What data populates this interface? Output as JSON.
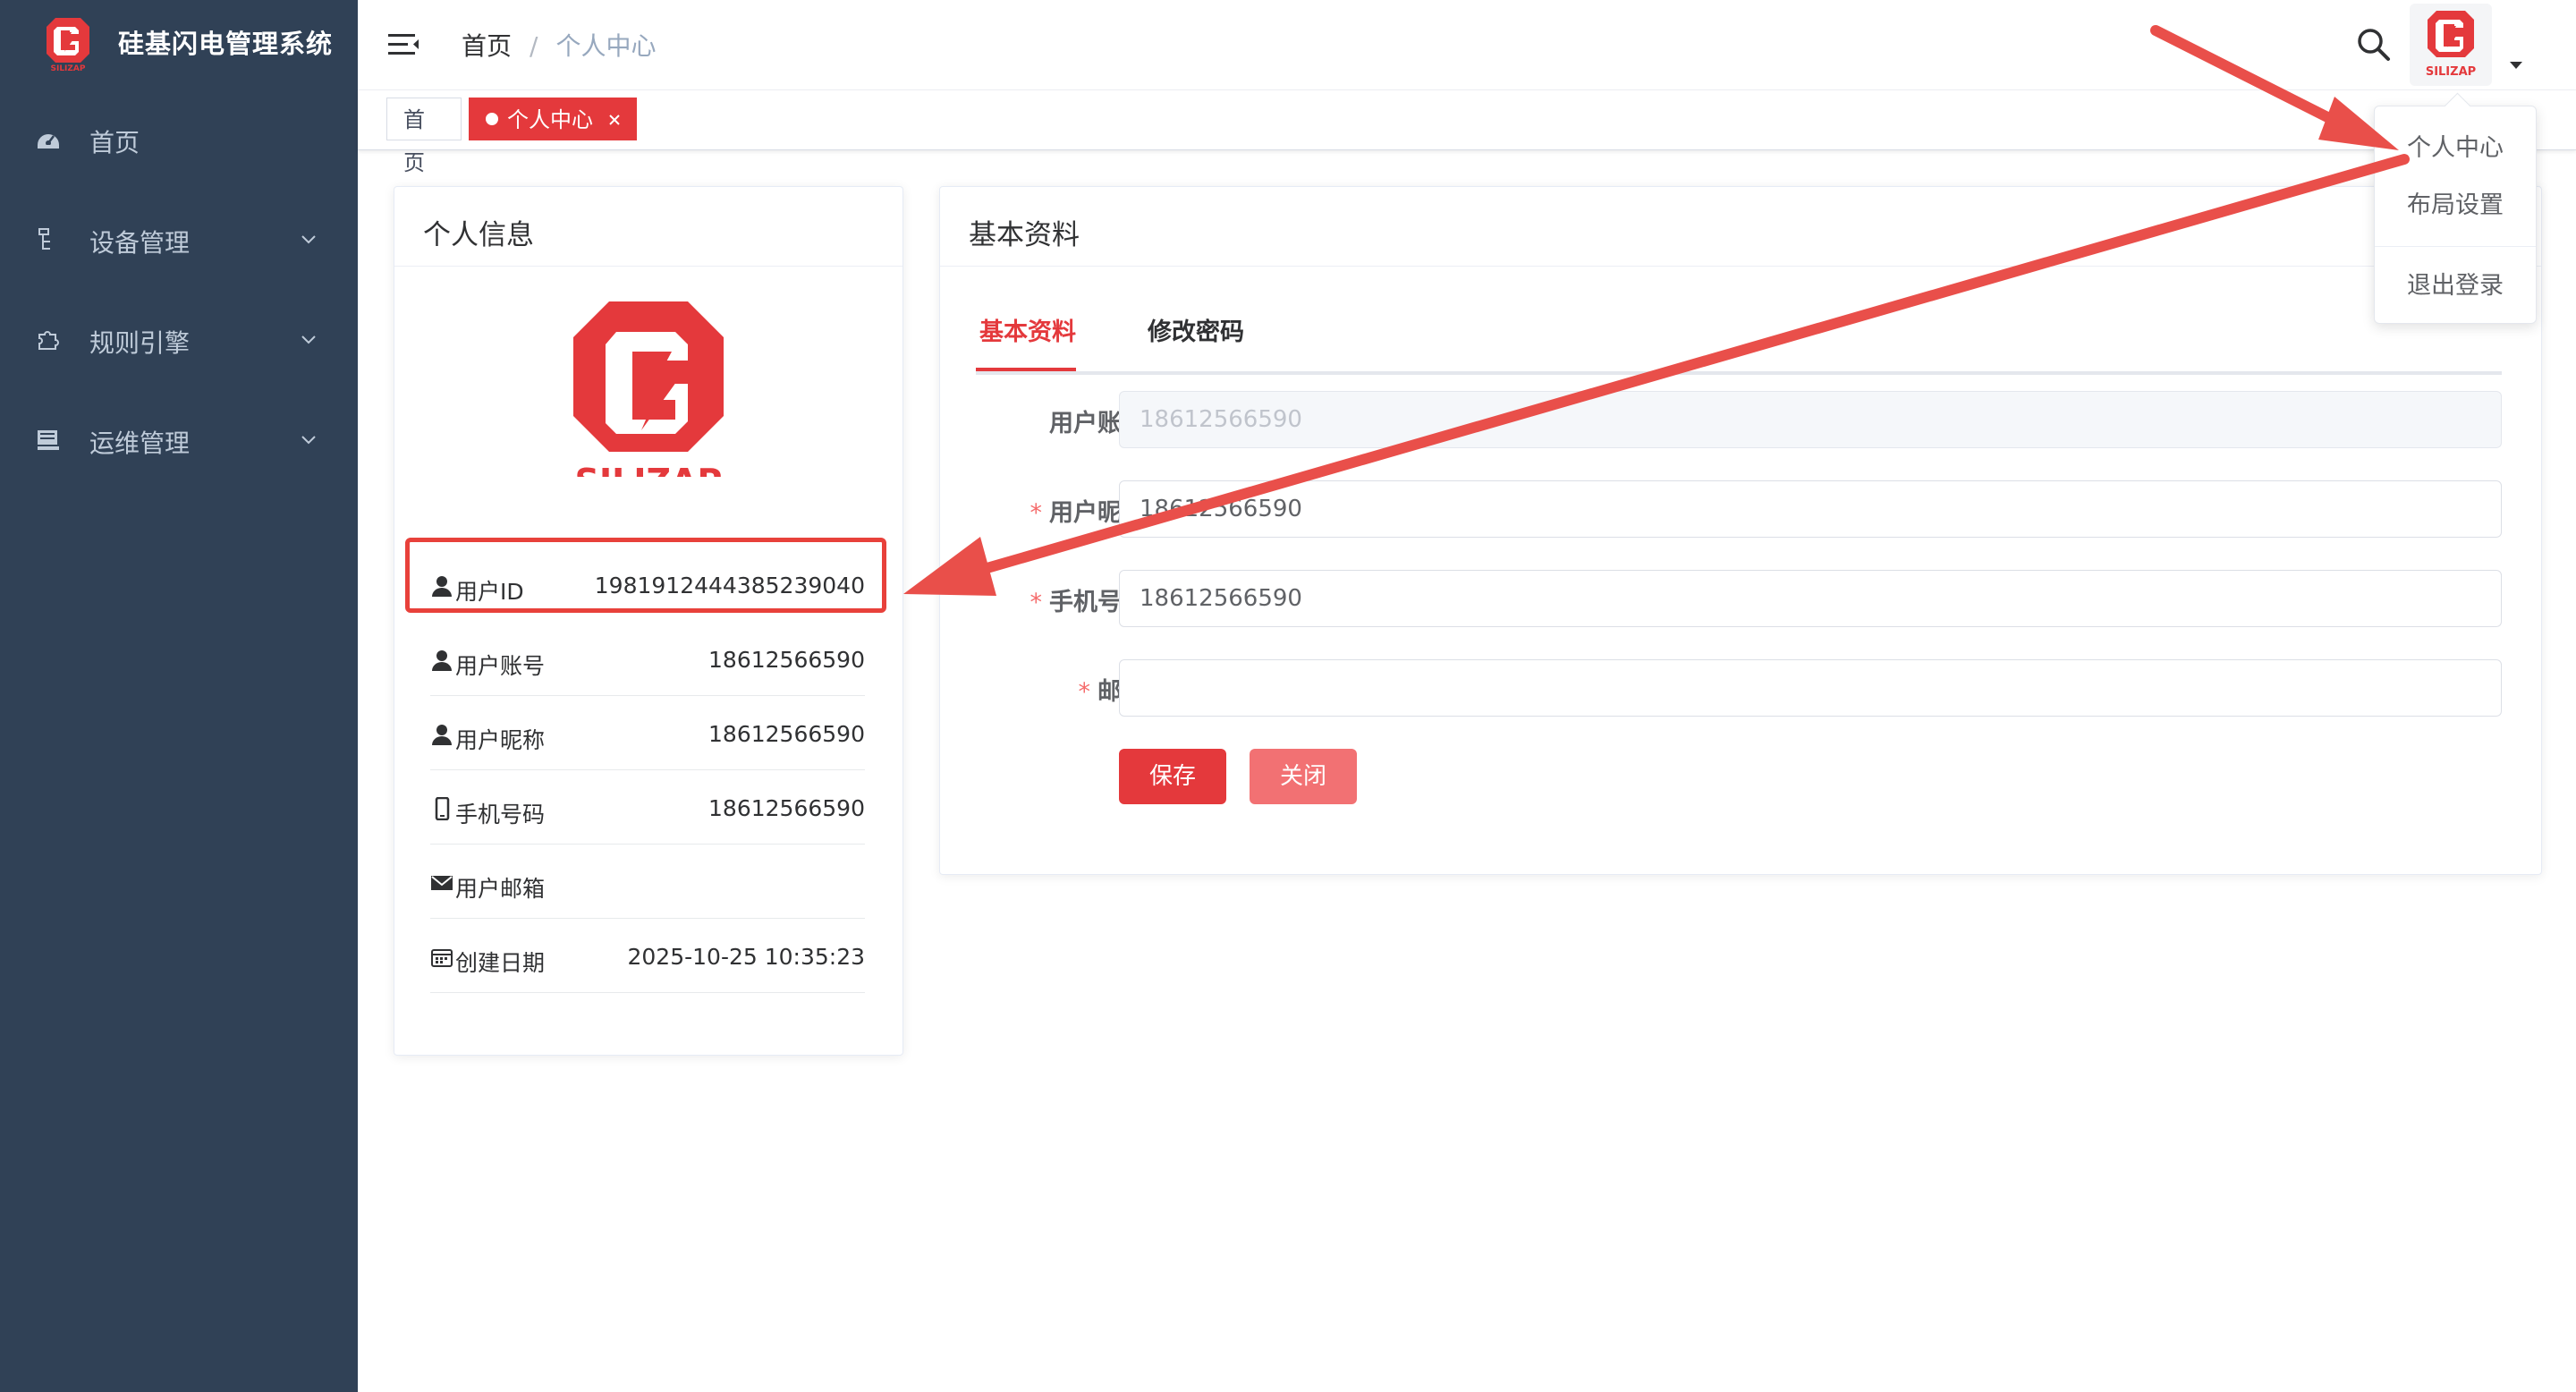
{
  "app": {
    "title": "硅基闪电管理系统",
    "brand_color": "#e4393c",
    "sidebar_color": "#304156",
    "logo_text": "SILIZAP"
  },
  "sidebar": {
    "items": [
      {
        "label": "首页",
        "icon": "dashboard-icon"
      },
      {
        "label": "设备管理",
        "icon": "device-tree-icon"
      },
      {
        "label": "规则引擎",
        "icon": "puzzle-icon"
      },
      {
        "label": "运维管理",
        "icon": "server-icon"
      }
    ]
  },
  "header": {
    "breadcrumb": {
      "home": "首页",
      "separator": "/",
      "current": "个人中心"
    }
  },
  "tags": {
    "home": "首页",
    "active": "个人中心"
  },
  "profile": {
    "title": "个人信息",
    "rows": [
      {
        "label": "用户ID",
        "value": "1981912444385239040",
        "icon": "user-icon"
      },
      {
        "label": "用户账号",
        "value": "18612566590",
        "icon": "user-icon"
      },
      {
        "label": "用户昵称",
        "value": "18612566590",
        "icon": "user-icon"
      },
      {
        "label": "手机号码",
        "value": "18612566590",
        "icon": "phone-icon"
      },
      {
        "label": "用户邮箱",
        "value": "",
        "icon": "mail-icon"
      },
      {
        "label": "创建日期",
        "value": "2025-10-25 10:35:23",
        "icon": "calendar-icon"
      }
    ]
  },
  "basic": {
    "title": "基本资料",
    "tabs": [
      "基本资料",
      "修改密码"
    ],
    "fields": {
      "account": {
        "label": "用户账号",
        "value": "18612566590"
      },
      "nickname": {
        "label": "用户昵称",
        "value": "18612566590"
      },
      "phone": {
        "label": "手机号码",
        "value": "18612566590"
      },
      "email": {
        "label": "邮箱",
        "value": ""
      }
    },
    "required_mark": "*",
    "save": "保存",
    "close": "关闭"
  },
  "dropdown": {
    "items": [
      "个人中心",
      "布局设置",
      "退出登录"
    ]
  }
}
